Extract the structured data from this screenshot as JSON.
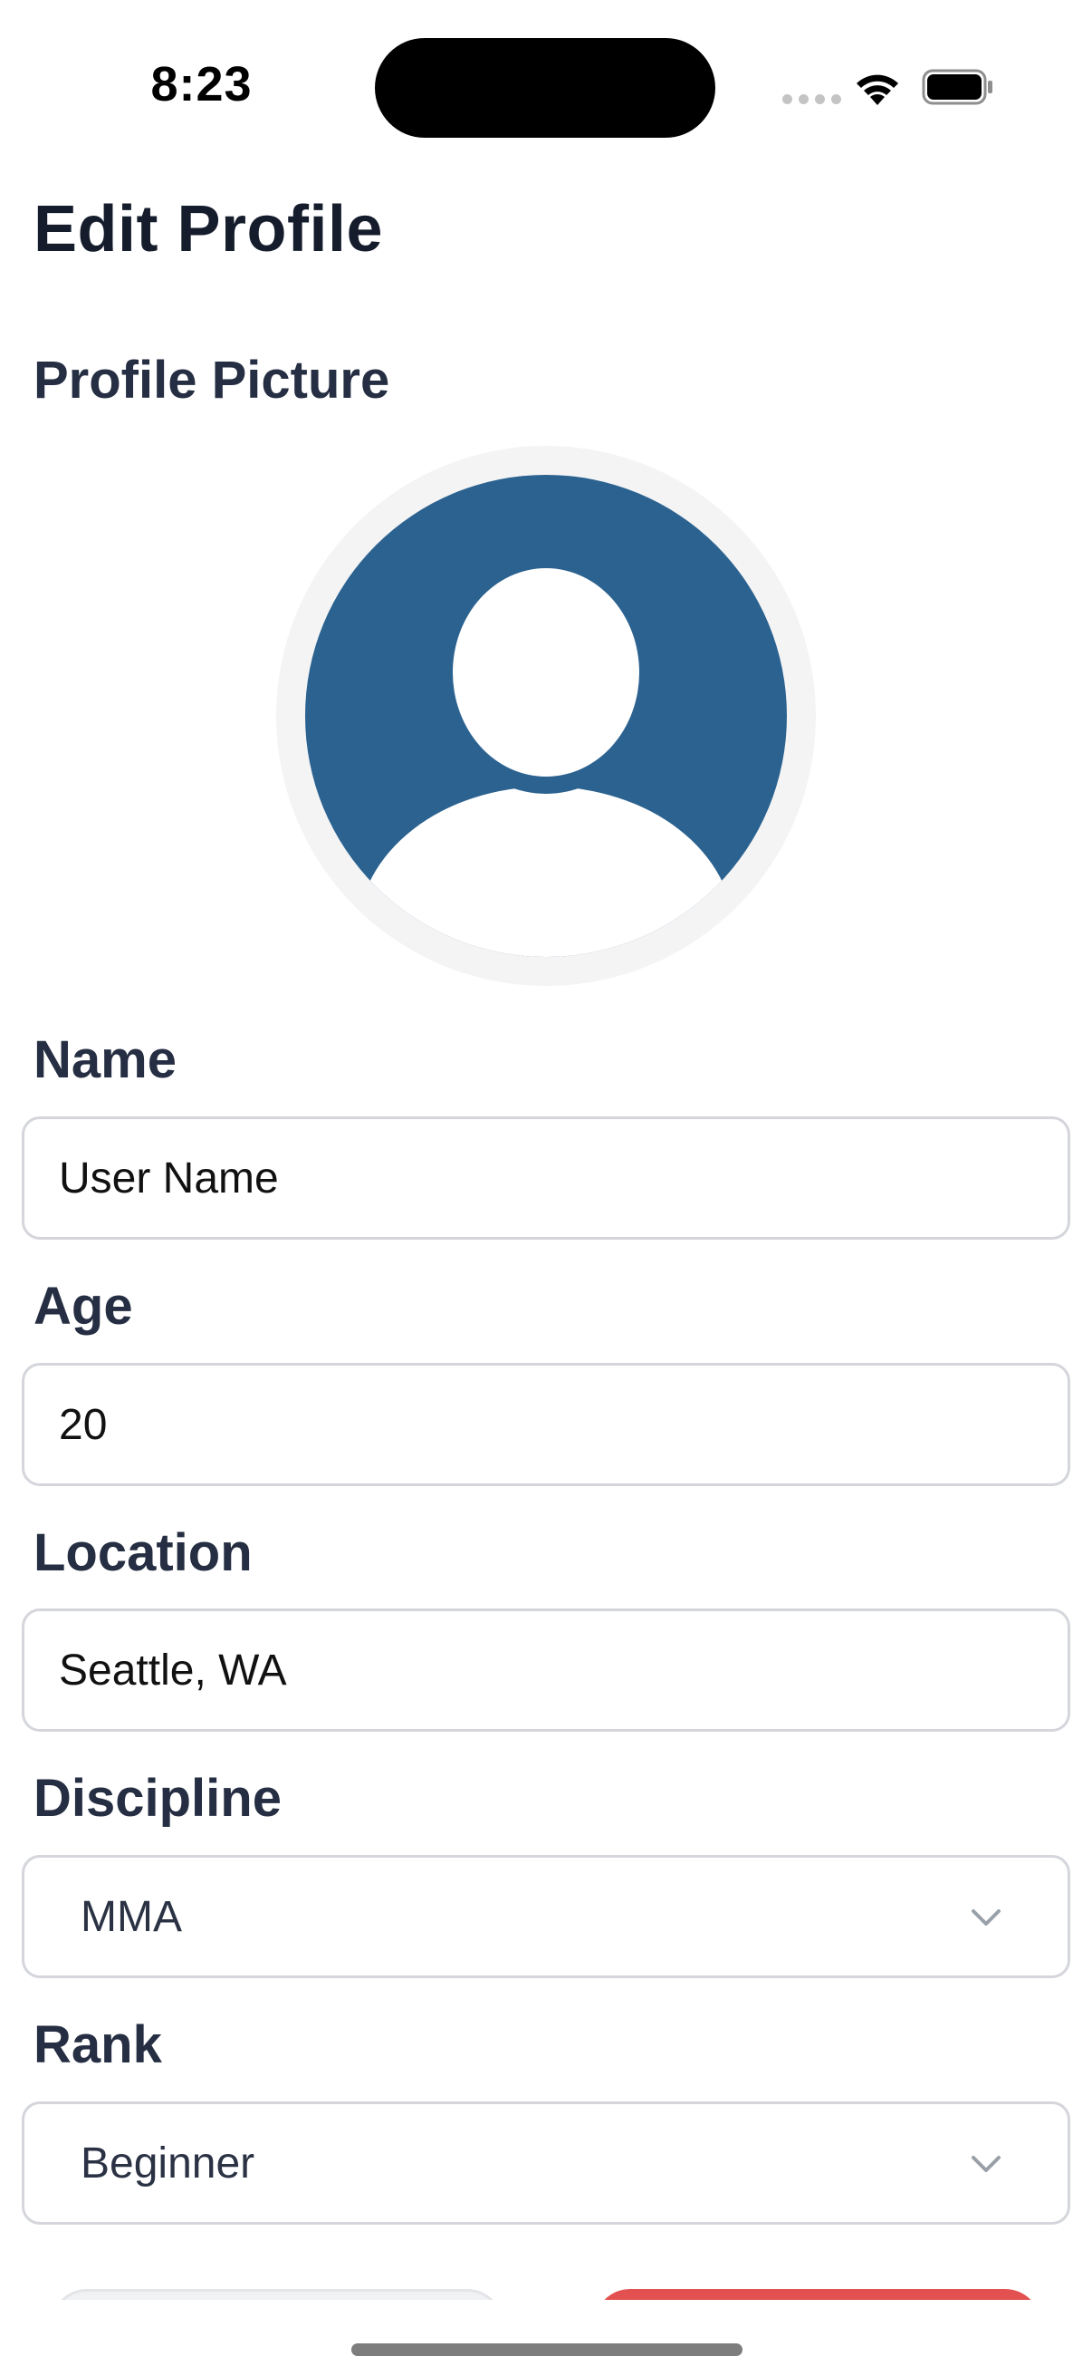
{
  "status_bar": {
    "time": "8:23"
  },
  "page": {
    "title": "Edit Profile"
  },
  "profile_picture": {
    "label": "Profile Picture",
    "avatar_color": "#2b6290",
    "icon": "default-avatar-icon"
  },
  "form": {
    "name": {
      "label": "Name",
      "value": "User Name"
    },
    "age": {
      "label": "Age",
      "value": "20"
    },
    "location": {
      "label": "Location",
      "value": "Seattle, WA"
    },
    "discipline": {
      "label": "Discipline",
      "value": "MMA"
    },
    "rank": {
      "label": "Rank",
      "value": "Beginner"
    }
  },
  "colors": {
    "accent": "#2b6290",
    "destructive": "#e2504f",
    "border": "#d4d6dc"
  }
}
